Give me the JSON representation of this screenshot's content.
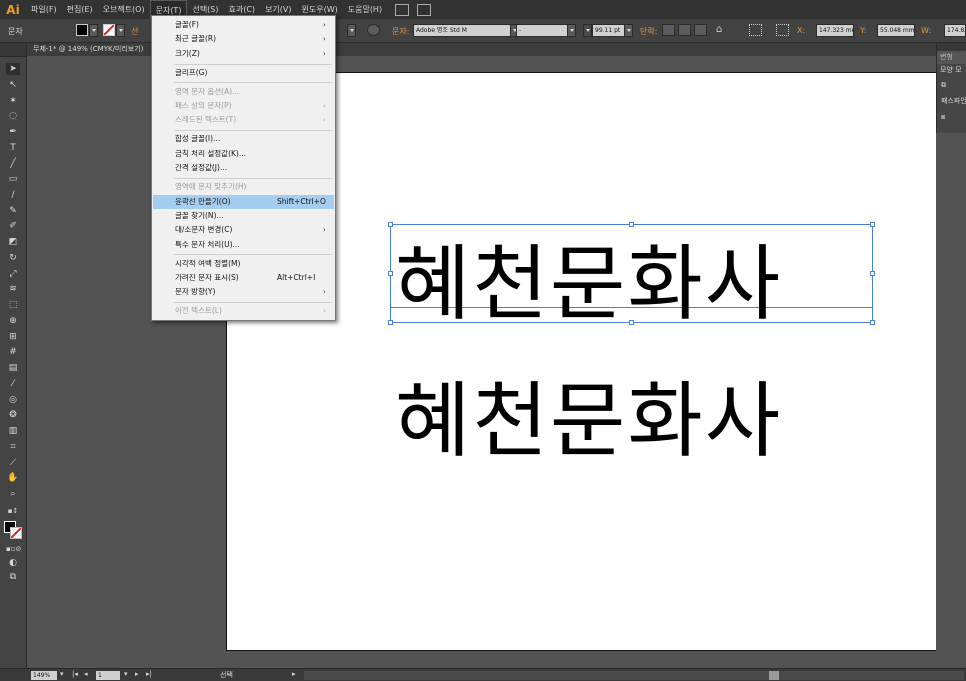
{
  "app": {
    "logo": "Ai"
  },
  "menubar": {
    "items": [
      {
        "label": "파일(F)"
      },
      {
        "label": "편집(E)"
      },
      {
        "label": "오브젝트(O)"
      },
      {
        "label": "문자(T)"
      },
      {
        "label": "선택(S)"
      },
      {
        "label": "효과(C)"
      },
      {
        "label": "보기(V)"
      },
      {
        "label": "윈도우(W)"
      },
      {
        "label": "도움말(H)"
      }
    ]
  },
  "controlbar": {
    "object_type": "문자",
    "stroke_label": "선",
    "char_label": "문자:",
    "font_name": "Adobe 명조 Std M",
    "font_style": "-",
    "font_size": "99.11 pt",
    "paragraph_label": "단락:",
    "x_label": "X:",
    "x_value": "147.323 mm",
    "y_label": "Y:",
    "y_value": "55.048 mm",
    "w_label": "W:",
    "w_value": "174.82"
  },
  "document": {
    "tab_title": "무제-1* @ 149% (CMYK/미리보기)"
  },
  "canvas": {
    "line1": "혜천문화사",
    "line2": "혜천문화사"
  },
  "right_panel": {
    "tab_top": "변형",
    "tab_shape": "모양 모",
    "pathfinder": "패스파인"
  },
  "statusbar": {
    "zoom": "149%",
    "page": "1",
    "tool_name": "선택"
  },
  "type_menu": {
    "items": [
      {
        "label": "글꼴(F)",
        "shortcut": "",
        "submenu": true,
        "enabled": true
      },
      {
        "label": "최근 글꼴(R)",
        "shortcut": "",
        "submenu": true,
        "enabled": true
      },
      {
        "label": "크기(Z)",
        "shortcut": "",
        "submenu": true,
        "enabled": true
      },
      {
        "label": "글리프(G)",
        "shortcut": "",
        "submenu": false,
        "enabled": true
      },
      {
        "label": "영역 문자 옵션(A)...",
        "shortcut": "",
        "submenu": false,
        "enabled": false
      },
      {
        "label": "패스 상의 문자(P)",
        "shortcut": "",
        "submenu": true,
        "enabled": false
      },
      {
        "label": "스레드된 텍스트(T)",
        "shortcut": "",
        "submenu": true,
        "enabled": false
      },
      {
        "label": "합성 글꼴(I)...",
        "shortcut": "",
        "submenu": false,
        "enabled": true
      },
      {
        "label": "금칙 처리 설정값(K)...",
        "shortcut": "",
        "submenu": false,
        "enabled": true
      },
      {
        "label": "간격 설정값(J)...",
        "shortcut": "",
        "submenu": false,
        "enabled": true
      },
      {
        "label": "영역에 문자 맞추기(H)",
        "shortcut": "",
        "submenu": false,
        "enabled": false
      },
      {
        "label": "윤곽선 만들기(O)",
        "shortcut": "Shift+Ctrl+O",
        "submenu": false,
        "enabled": true
      },
      {
        "label": "글꼴 찾기(N)...",
        "shortcut": "",
        "submenu": false,
        "enabled": true
      },
      {
        "label": "대/소문자 변경(C)",
        "shortcut": "",
        "submenu": true,
        "enabled": true
      },
      {
        "label": "특수 문자 처리(U)...",
        "shortcut": "",
        "submenu": false,
        "enabled": true
      },
      {
        "label": "시각적 여백 정렬(M)",
        "shortcut": "",
        "submenu": false,
        "enabled": true
      },
      {
        "label": "가려진 문자 표시(S)",
        "shortcut": "Alt+Ctrl+I",
        "submenu": false,
        "enabled": true
      },
      {
        "label": "문자 방향(Y)",
        "shortcut": "",
        "submenu": true,
        "enabled": true
      },
      {
        "label": "이전 텍스트(L)",
        "shortcut": "",
        "submenu": true,
        "enabled": false
      }
    ],
    "highlighted_index": 11
  },
  "colors": {
    "menubar_bg": "#323232",
    "panel_bg": "#444444",
    "highlight": "#a5cdf0",
    "selection": "#4a7fd8",
    "label_accent": "#e89a3a"
  }
}
